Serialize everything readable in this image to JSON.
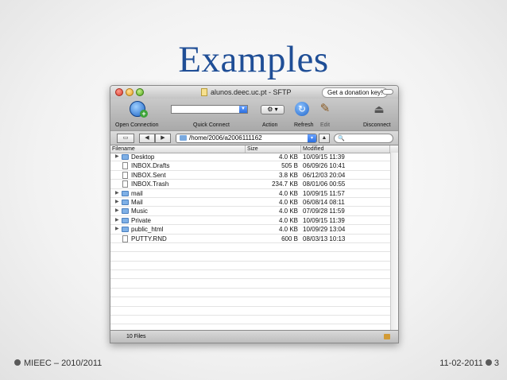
{
  "slide": {
    "title": "Examples",
    "footer_left": "MIEEC – 2010/2011",
    "footer_date": "11-02-2011",
    "page_number": "3"
  },
  "window": {
    "title": "alunos.deec.uc.pt - SFTP",
    "donation_button": "Get a donation key!"
  },
  "toolbar": {
    "open_connection": "Open Connection",
    "quick_connect": "Quick Connect",
    "action": "Action",
    "action_glyph": "⚙ ▾",
    "refresh": "Refresh",
    "edit": "Edit",
    "disconnect": "Disconnect"
  },
  "pathbar": {
    "path": "/home/2006/a2006111162",
    "search_glyph": "🔍",
    "up_glyph": "▲",
    "back_glyph": "◀",
    "forward_glyph": "▶",
    "view_glyph": "▭"
  },
  "columns": {
    "filename": "Filename",
    "size": "Size",
    "modified": "Modified"
  },
  "files": [
    {
      "name": "Desktop",
      "size": "4.0 KB",
      "modified": "10/09/15 11:39",
      "kind": "folder"
    },
    {
      "name": "INBOX.Drafts",
      "size": "505 B",
      "modified": "06/09/26 10:41",
      "kind": "file"
    },
    {
      "name": "INBOX.Sent",
      "size": "3.8 KB",
      "modified": "06/12/03 20:04",
      "kind": "file"
    },
    {
      "name": "INBOX.Trash",
      "size": "234.7 KB",
      "modified": "08/01/06 00:55",
      "kind": "file"
    },
    {
      "name": "mail",
      "size": "4.0 KB",
      "modified": "10/09/15 11:57",
      "kind": "folder"
    },
    {
      "name": "Mail",
      "size": "4.0 KB",
      "modified": "06/08/14 08:11",
      "kind": "folder"
    },
    {
      "name": "Music",
      "size": "4.0 KB",
      "modified": "07/09/28 11:59",
      "kind": "folder"
    },
    {
      "name": "Private",
      "size": "4.0 KB",
      "modified": "10/09/15 11:39",
      "kind": "folder"
    },
    {
      "name": "public_html",
      "size": "4.0 KB",
      "modified": "10/09/29 13:04",
      "kind": "folder"
    },
    {
      "name": "PUTTY.RND",
      "size": "600 B",
      "modified": "08/03/13 10:13",
      "kind": "file"
    }
  ],
  "status": {
    "file_count": "10 Files"
  }
}
